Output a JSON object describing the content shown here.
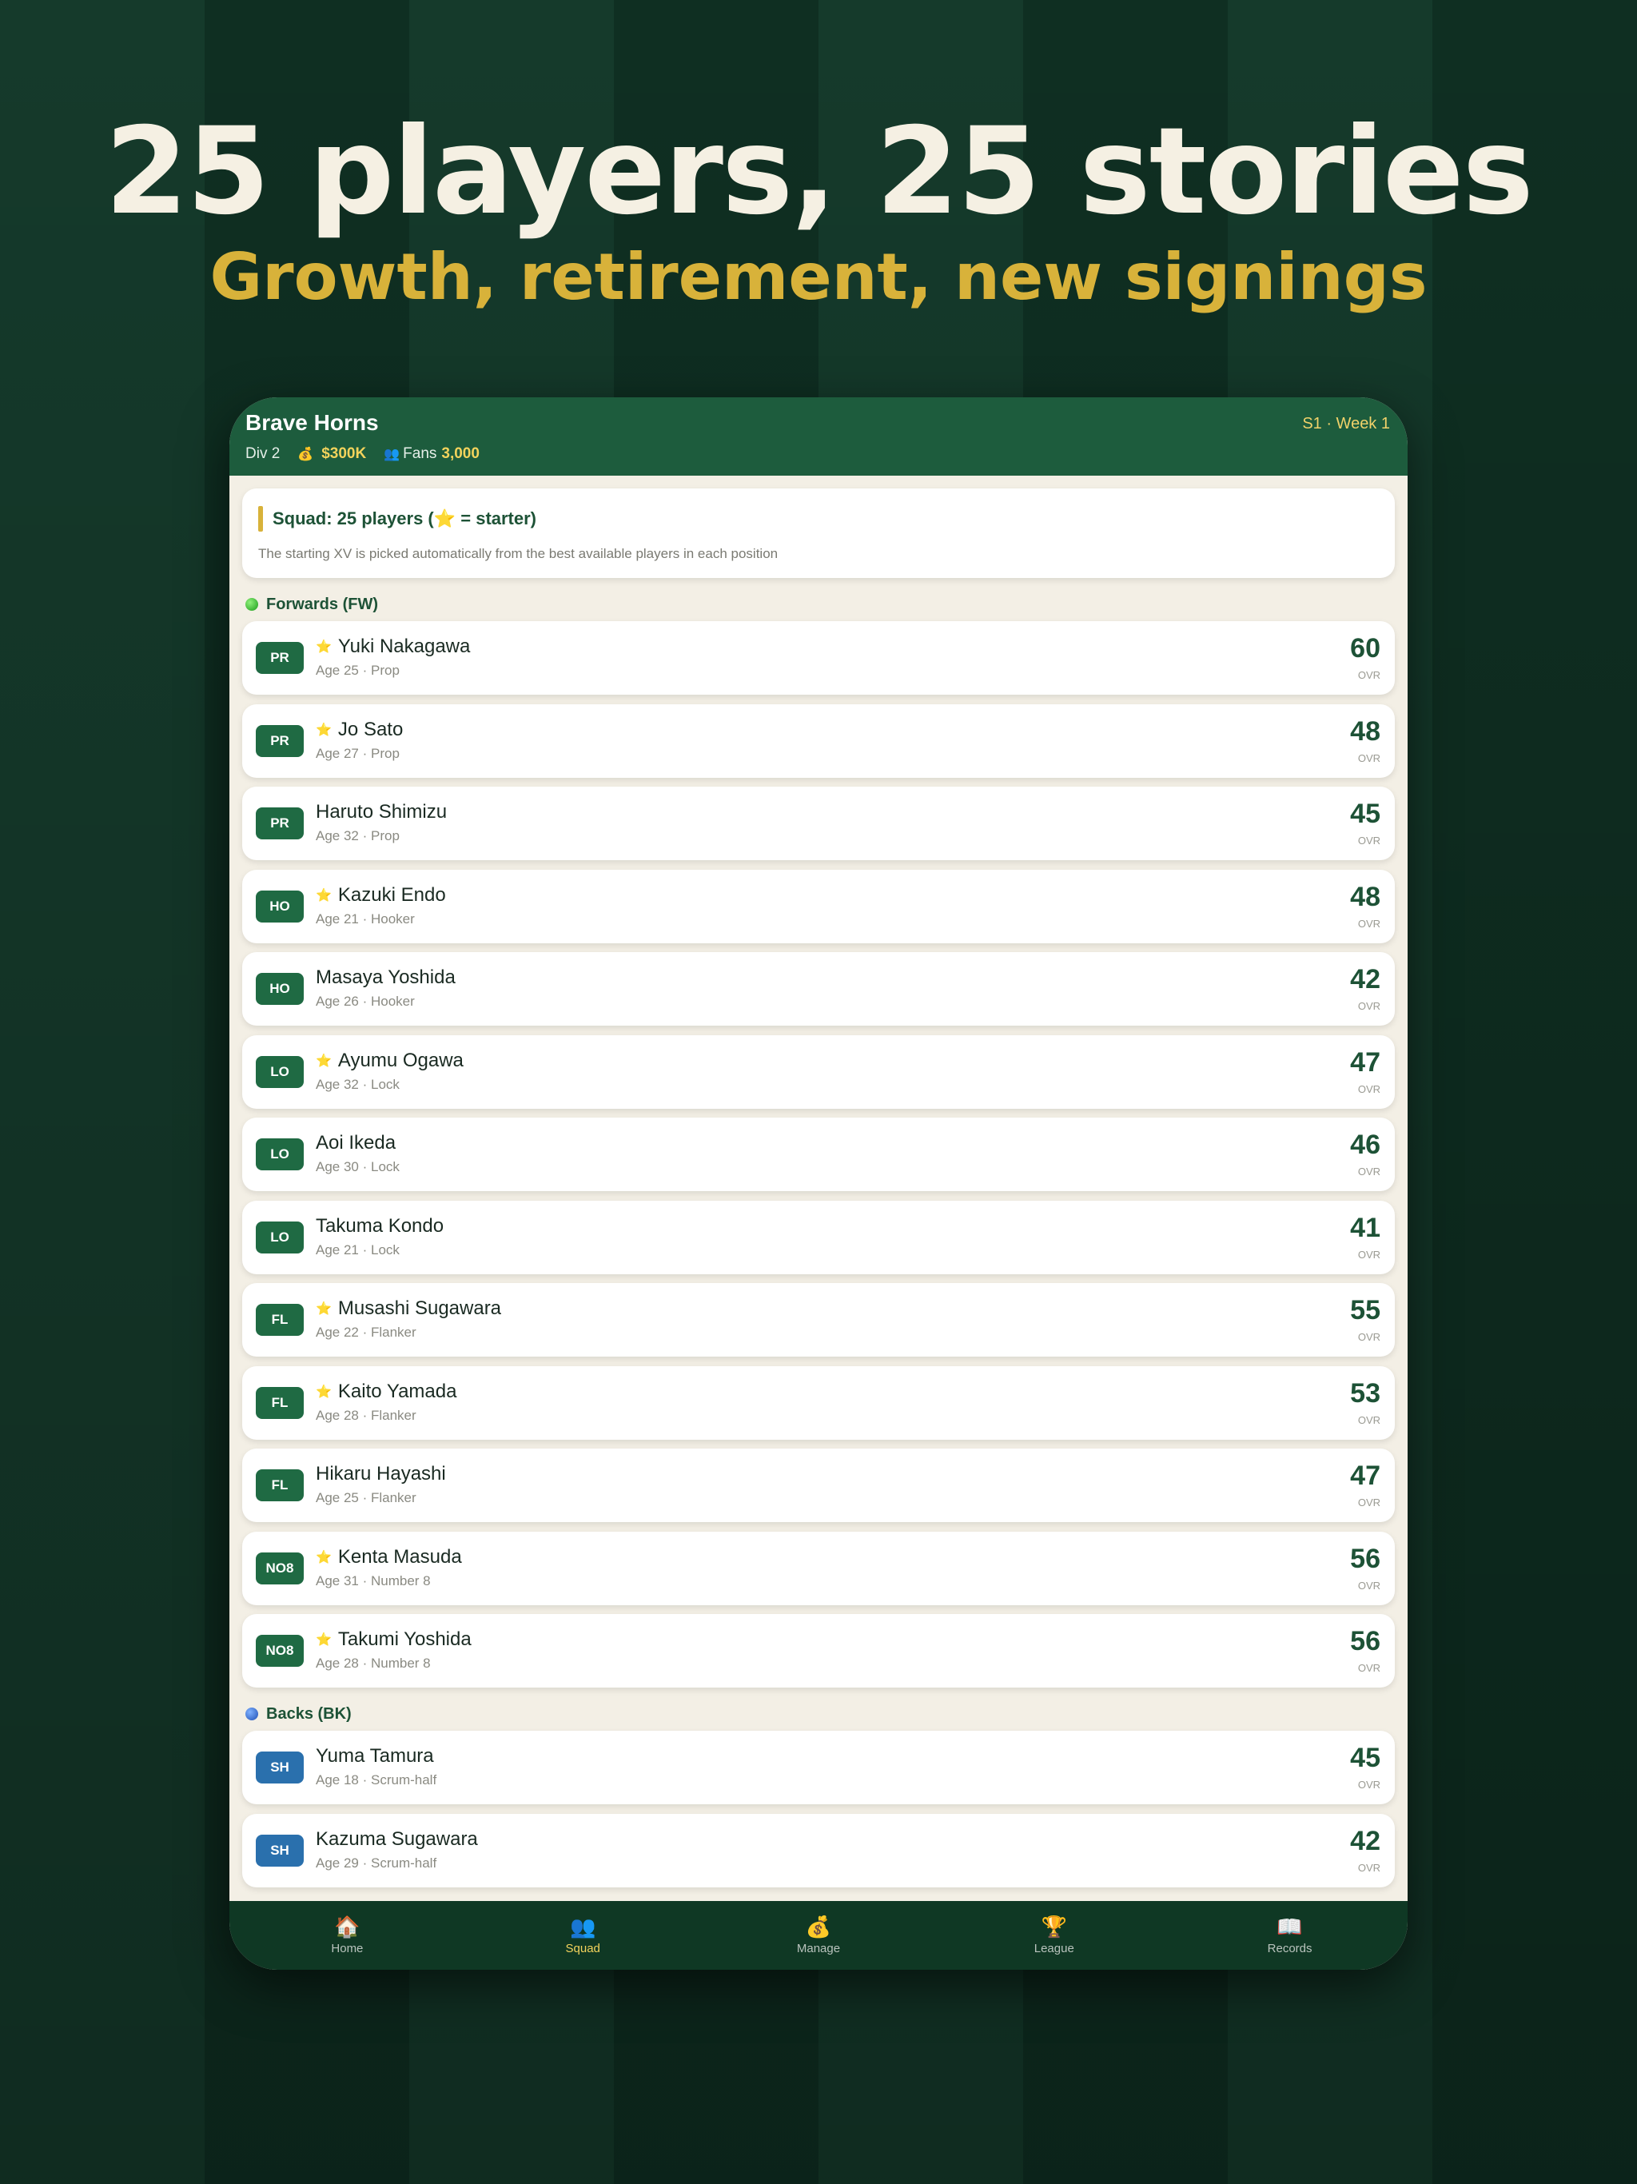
{
  "hero": {
    "title": "25 players, 25 stories",
    "subtitle": "Growth, retirement, new signings"
  },
  "header": {
    "team": "Brave Horns",
    "week": "S1 · Week 1",
    "division": "Div 2",
    "money_icon": "money-bag-icon",
    "money": "$300K",
    "fans_icon": "people-icon",
    "fans_label": "Fans",
    "fans": "3,000"
  },
  "squad": {
    "title": "Squad: 25 players (⭐ = starter)",
    "description": "The starting XV is picked automatically from the best available players in each position"
  },
  "forwards": {
    "label": "Forwards (FW)",
    "players": [
      {
        "pos": "PR",
        "name": "Yuki Nakagawa",
        "starter": true,
        "info": "Age 25 · Prop",
        "ovr": "60"
      },
      {
        "pos": "PR",
        "name": "Jo Sato",
        "starter": true,
        "info": "Age 27 · Prop",
        "ovr": "48"
      },
      {
        "pos": "PR",
        "name": "Haruto Shimizu",
        "starter": false,
        "info": "Age 32 · Prop",
        "ovr": "45"
      },
      {
        "pos": "HO",
        "name": "Kazuki Endo",
        "starter": true,
        "info": "Age 21 · Hooker",
        "ovr": "48"
      },
      {
        "pos": "HO",
        "name": "Masaya Yoshida",
        "starter": false,
        "info": "Age 26 · Hooker",
        "ovr": "42"
      },
      {
        "pos": "LO",
        "name": "Ayumu Ogawa",
        "starter": true,
        "info": "Age 32 · Lock",
        "ovr": "47"
      },
      {
        "pos": "LO",
        "name": "Aoi Ikeda",
        "starter": false,
        "info": "Age 30 · Lock",
        "ovr": "46"
      },
      {
        "pos": "LO",
        "name": "Takuma Kondo",
        "starter": false,
        "info": "Age 21 · Lock",
        "ovr": "41"
      },
      {
        "pos": "FL",
        "name": "Musashi Sugawara",
        "starter": true,
        "info": "Age 22 · Flanker",
        "ovr": "55"
      },
      {
        "pos": "FL",
        "name": "Kaito Yamada",
        "starter": true,
        "info": "Age 28 · Flanker",
        "ovr": "53"
      },
      {
        "pos": "FL",
        "name": "Hikaru Hayashi",
        "starter": false,
        "info": "Age 25 · Flanker",
        "ovr": "47"
      },
      {
        "pos": "NO8",
        "name": "Kenta Masuda",
        "starter": true,
        "info": "Age 31 · Number 8",
        "ovr": "56"
      },
      {
        "pos": "NO8",
        "name": "Takumi Yoshida",
        "starter": true,
        "info": "Age 28 · Number 8",
        "ovr": "56"
      }
    ]
  },
  "backs": {
    "label": "Backs (BK)",
    "players": [
      {
        "pos": "SH",
        "name": "Yuma Tamura",
        "starter": false,
        "info": "Age 18 · Scrum-half",
        "ovr": "45"
      },
      {
        "pos": "SH",
        "name": "Kazuma Sugawara",
        "starter": false,
        "info": "Age 29 · Scrum-half",
        "ovr": "42"
      }
    ]
  },
  "ovr_label": "OVR",
  "star_glyph": "⭐",
  "tabs": [
    {
      "label": "Home",
      "icon": "house-icon",
      "glyph": "🏠",
      "active": false
    },
    {
      "label": "Squad",
      "icon": "people-icon",
      "glyph": "👥",
      "active": true
    },
    {
      "label": "Manage",
      "icon": "money-bag-icon",
      "glyph": "💰",
      "active": false
    },
    {
      "label": "League",
      "icon": "trophy-icon",
      "glyph": "🏆",
      "active": false
    },
    {
      "label": "Records",
      "icon": "book-icon",
      "glyph": "📖",
      "active": false
    }
  ],
  "colors": {
    "header_green": "#1d5c3d",
    "accent_gold": "#d8b23a",
    "forward_badge": "#1f6a43",
    "back_badge": "#2a70ad"
  }
}
